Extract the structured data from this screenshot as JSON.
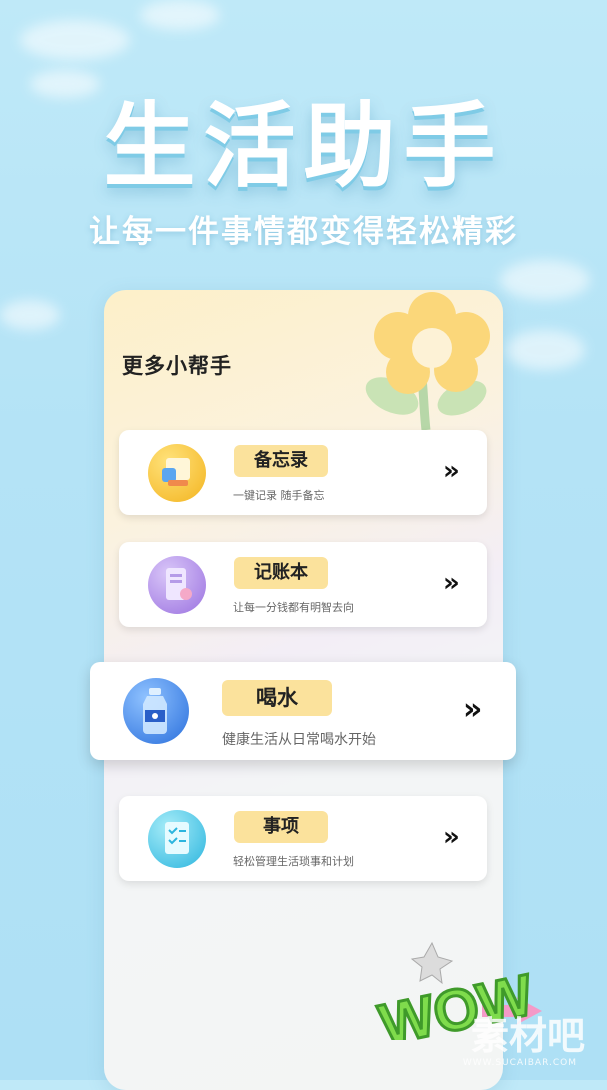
{
  "hero": {
    "title": "生活助手",
    "subtitle": "让每一件事情都变得轻松精彩"
  },
  "panel": {
    "title": "更多小帮手"
  },
  "cards": [
    {
      "name": "备忘录",
      "desc": "一键记录 随手备忘",
      "icon": "memo-icon",
      "color": "#f7c93a"
    },
    {
      "name": "记账本",
      "desc": "让每一分钱都有明智去向",
      "icon": "ledger-icon",
      "color": "#b08ee6"
    },
    {
      "name": "喝水",
      "desc": "健康生活从日常喝水开始",
      "icon": "water-bottle-icon",
      "color": "#3e86e8"
    },
    {
      "name": "事项",
      "desc": "轻松管理生活琐事和计划",
      "icon": "checklist-icon",
      "color": "#45c6e6"
    }
  ],
  "arrow": "»",
  "decor": {
    "wow_text": "WOW"
  },
  "watermark": {
    "text": "素材吧",
    "sub": "WWW.SUCAIBAR.COM"
  }
}
